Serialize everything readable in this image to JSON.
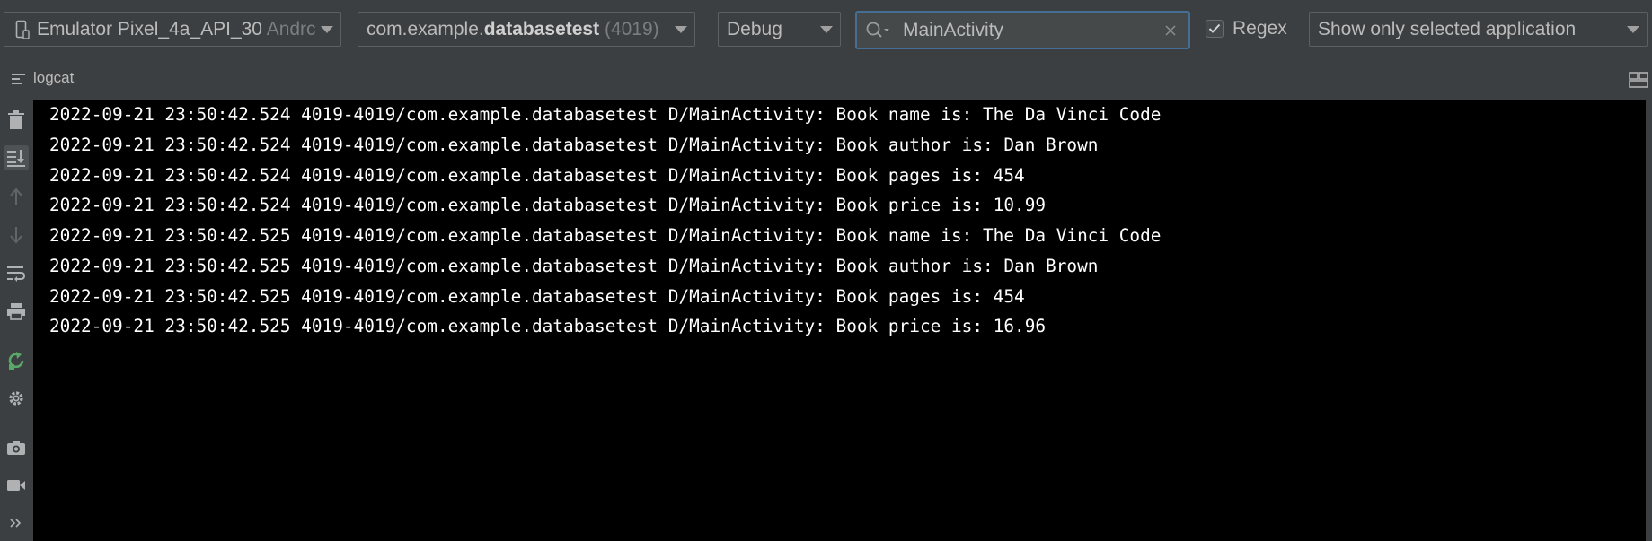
{
  "toolbar": {
    "device": {
      "name": "Emulator Pixel_4a_API_30",
      "suffix": "Andrc",
      "icon": "phone-icon"
    },
    "process": {
      "prefix": "com.example.",
      "bold": "databasetest",
      "pid": "(4019)"
    },
    "level": "Debug",
    "search": {
      "value": "MainActivity",
      "icon": "search-icon",
      "clear_icon": "close-icon"
    },
    "regex": {
      "label": "Regex",
      "checked": true
    },
    "filter": "Show only selected application"
  },
  "panel": {
    "title": "logcat",
    "menu_icon": "lines-icon",
    "layout_icon": "layout-icon"
  },
  "sidebar": {
    "items": [
      {
        "name": "clear-logcat",
        "icon": "trash-icon"
      },
      {
        "name": "scroll-to-end",
        "icon": "scroll-to-end-icon",
        "active": true
      },
      {
        "name": "up-stack-trace",
        "icon": "arrow-up-icon"
      },
      {
        "name": "down-stack-trace",
        "icon": "arrow-down-icon"
      },
      {
        "name": "soft-wrap",
        "icon": "soft-wrap-icon"
      },
      {
        "name": "print",
        "icon": "printer-icon"
      },
      {
        "name": "restart",
        "icon": "restart-icon"
      },
      {
        "name": "settings",
        "icon": "gear-icon"
      },
      {
        "name": "screen-capture",
        "icon": "camera-icon"
      },
      {
        "name": "screen-record",
        "icon": "video-camera-icon"
      },
      {
        "name": "more",
        "icon": "double-chevron-icon"
      }
    ]
  },
  "log": {
    "lines": [
      "2022-09-21 23:50:42.524 4019-4019/com.example.databasetest D/MainActivity: Book name is: The Da Vinci Code",
      "2022-09-21 23:50:42.524 4019-4019/com.example.databasetest D/MainActivity: Book author is: Dan Brown",
      "2022-09-21 23:50:42.524 4019-4019/com.example.databasetest D/MainActivity: Book pages is: 454",
      "2022-09-21 23:50:42.524 4019-4019/com.example.databasetest D/MainActivity: Book price is: 10.99",
      "2022-09-21 23:50:42.525 4019-4019/com.example.databasetest D/MainActivity: Book name is: The Da Vinci Code",
      "2022-09-21 23:50:42.525 4019-4019/com.example.databasetest D/MainActivity: Book author is: Dan Brown",
      "2022-09-21 23:50:42.525 4019-4019/com.example.databasetest D/MainActivity: Book pages is: 454",
      "2022-09-21 23:50:42.525 4019-4019/com.example.databasetest D/MainActivity: Book price is: 16.96"
    ]
  },
  "colors": {
    "background": "#3c3f41",
    "console": "#000000",
    "focus": "#466d94",
    "accent_green": "#59a869"
  }
}
